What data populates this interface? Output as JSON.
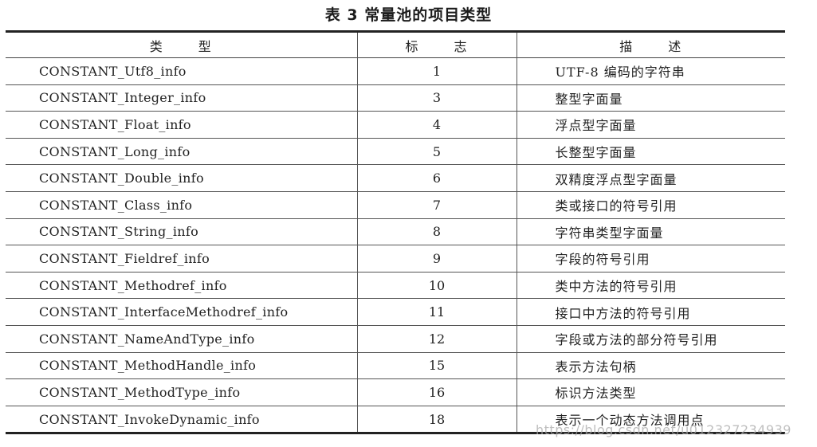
{
  "caption": "表 3  常量池的项目类型",
  "columns": {
    "type": "类 型",
    "tag": "标 志",
    "desc": "描 述"
  },
  "rows": [
    {
      "type": "CONSTANT_Utf8_info",
      "tag": "1",
      "desc": "UTF-8 编码的字符串"
    },
    {
      "type": "CONSTANT_Integer_info",
      "tag": "3",
      "desc": "整型字面量"
    },
    {
      "type": "CONSTANT_Float_info",
      "tag": "4",
      "desc": "浮点型字面量"
    },
    {
      "type": "CONSTANT_Long_info",
      "tag": "5",
      "desc": "长整型字面量"
    },
    {
      "type": "CONSTANT_Double_info",
      "tag": "6",
      "desc": "双精度浮点型字面量"
    },
    {
      "type": "CONSTANT_Class_info",
      "tag": "7",
      "desc": "类或接口的符号引用"
    },
    {
      "type": "CONSTANT_String_info",
      "tag": "8",
      "desc": "字符串类型字面量"
    },
    {
      "type": "CONSTANT_Fieldref_info",
      "tag": "9",
      "desc": "字段的符号引用"
    },
    {
      "type": "CONSTANT_Methodref_info",
      "tag": "10",
      "desc": "类中方法的符号引用"
    },
    {
      "type": "CONSTANT_InterfaceMethodref_info",
      "tag": "11",
      "desc": "接口中方法的符号引用"
    },
    {
      "type": "CONSTANT_NameAndType_info",
      "tag": "12",
      "desc": "字段或方法的部分符号引用"
    },
    {
      "type": "CONSTANT_MethodHandle_info",
      "tag": "15",
      "desc": "表示方法句柄"
    },
    {
      "type": "CONSTANT_MethodType_info",
      "tag": "16",
      "desc": "标识方法类型"
    },
    {
      "type": "CONSTANT_InvokeDynamic_info",
      "tag": "18",
      "desc": "表示一个动态方法调用点"
    }
  ],
  "watermark": "https://blog.csdn.net/u012327234939"
}
